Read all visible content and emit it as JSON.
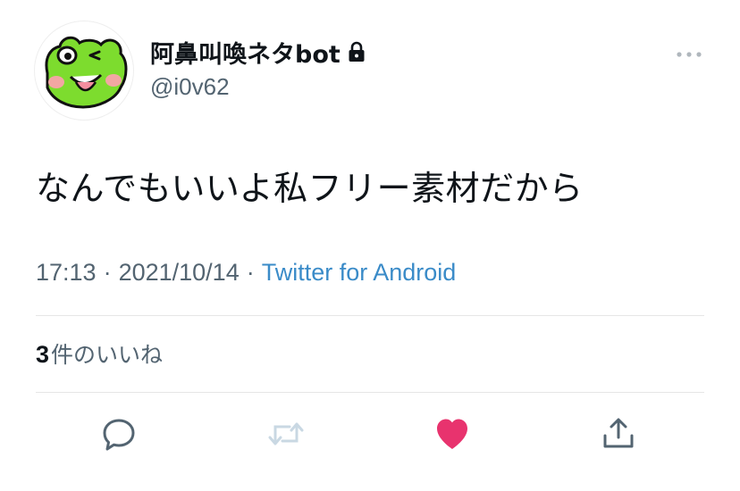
{
  "tweet": {
    "author": {
      "display_name": "阿鼻叫喚ネタbot",
      "handle": "@i0v62",
      "protected": true,
      "avatar": "frog-face-avatar"
    },
    "text": "なんでもいいよ私フリー素材だから",
    "time": "17:13",
    "date": "2021/10/14",
    "separator": "·",
    "source": "Twitter for Android",
    "likes": {
      "count": "3",
      "label": "件のいいね"
    }
  },
  "icons": {
    "more": "more-horizontal-icon",
    "lock": "lock-icon",
    "reply": "reply-bubble-icon",
    "retweet": "retweet-icon",
    "like": "heart-icon",
    "share": "share-icon"
  },
  "colors": {
    "primary_text": "#0f1419",
    "secondary_text": "#536471",
    "link": "#3a8bc8",
    "like_active": "#e8336e",
    "retweet_disabled": "#c9d8e3",
    "divider": "#e6e6e6"
  }
}
